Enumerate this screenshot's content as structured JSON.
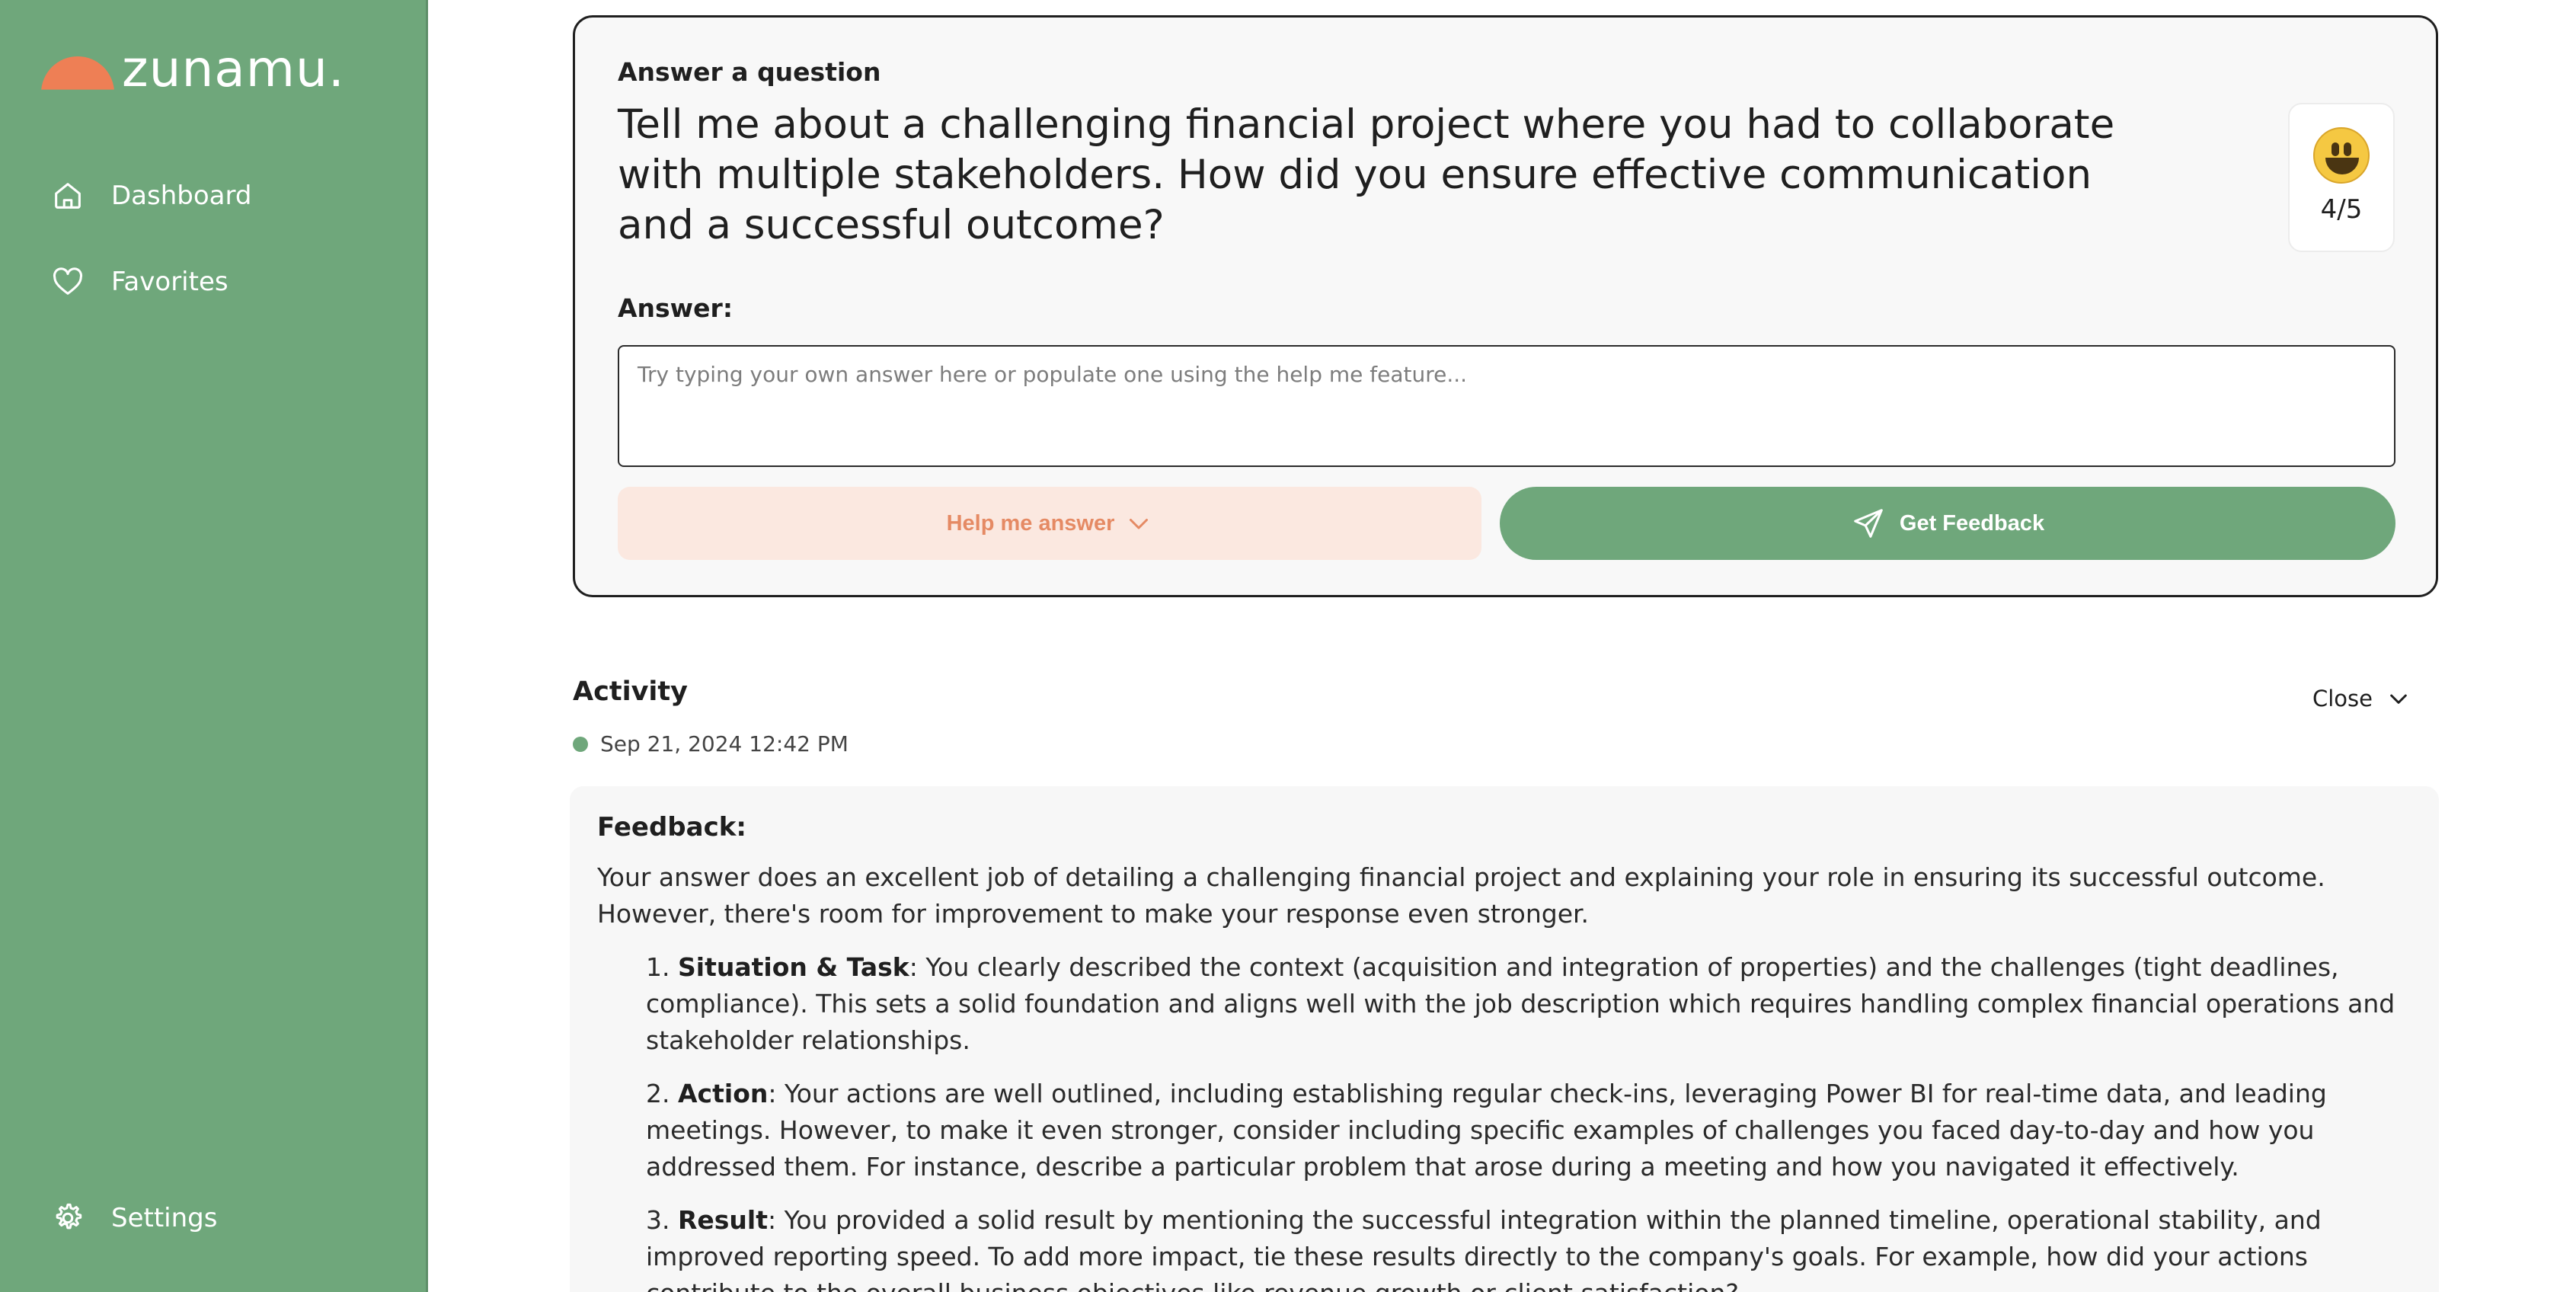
{
  "app": {
    "name": "zunamu."
  },
  "sidebar": {
    "items": [
      {
        "label": "Dashboard",
        "icon": "home-icon"
      },
      {
        "label": "Favorites",
        "icon": "heart-icon"
      }
    ],
    "settings": {
      "label": "Settings",
      "icon": "gear-icon"
    }
  },
  "question": {
    "label": "Answer a question",
    "text": "Tell me about a challenging financial project where you had to collaborate with multiple stakeholders. How did you ensure effective communication and a successful outcome?",
    "score": "4/5",
    "score_icon": "smiley-icon"
  },
  "answer": {
    "label": "Answer:",
    "value": "",
    "placeholder": "Try typing your own answer here or populate one using the help me feature..."
  },
  "buttons": {
    "help": "Help me answer",
    "feedback": "Get Feedback"
  },
  "activity": {
    "title": "Activity",
    "toggle": "Close",
    "timestamp": "Sep 21, 2024 12:42 PM"
  },
  "feedback": {
    "label": "Feedback:",
    "intro": "Your answer does an excellent job of detailing a challenging financial project and explaining your role in ensuring its successful outcome. However, there's room for improvement to make your response even stronger.",
    "items": [
      {
        "number": "1.",
        "title": "Situation & Task",
        "text": ": You clearly described the context (acquisition and integration of properties) and the challenges (tight deadlines, compliance). This sets a solid foundation and aligns well with the job description which requires handling complex financial operations and stakeholder relationships."
      },
      {
        "number": "2.",
        "title": "Action",
        "text": ": Your actions are well outlined, including establishing regular check-ins, leveraging Power BI for real-time data, and leading meetings. However, to make it even stronger, consider including specific examples of challenges you faced day-to-day and how you addressed them. For instance, describe a particular problem that arose during a meeting and how you navigated it effectively."
      },
      {
        "number": "3.",
        "title": "Result",
        "text": ": You provided a solid result by mentioning the successful integration within the planned timeline, operational stability, and improved reporting speed. To add more impact, tie these results directly to the company's goals. For example, how did your actions contribute to the overall business objectives like revenue growth or client satisfaction?"
      }
    ]
  },
  "colors": {
    "brand_green": "#6fa77b",
    "brand_orange": "#ee7f55",
    "help_bg": "#fbe8e0",
    "help_text": "#e58a64"
  }
}
